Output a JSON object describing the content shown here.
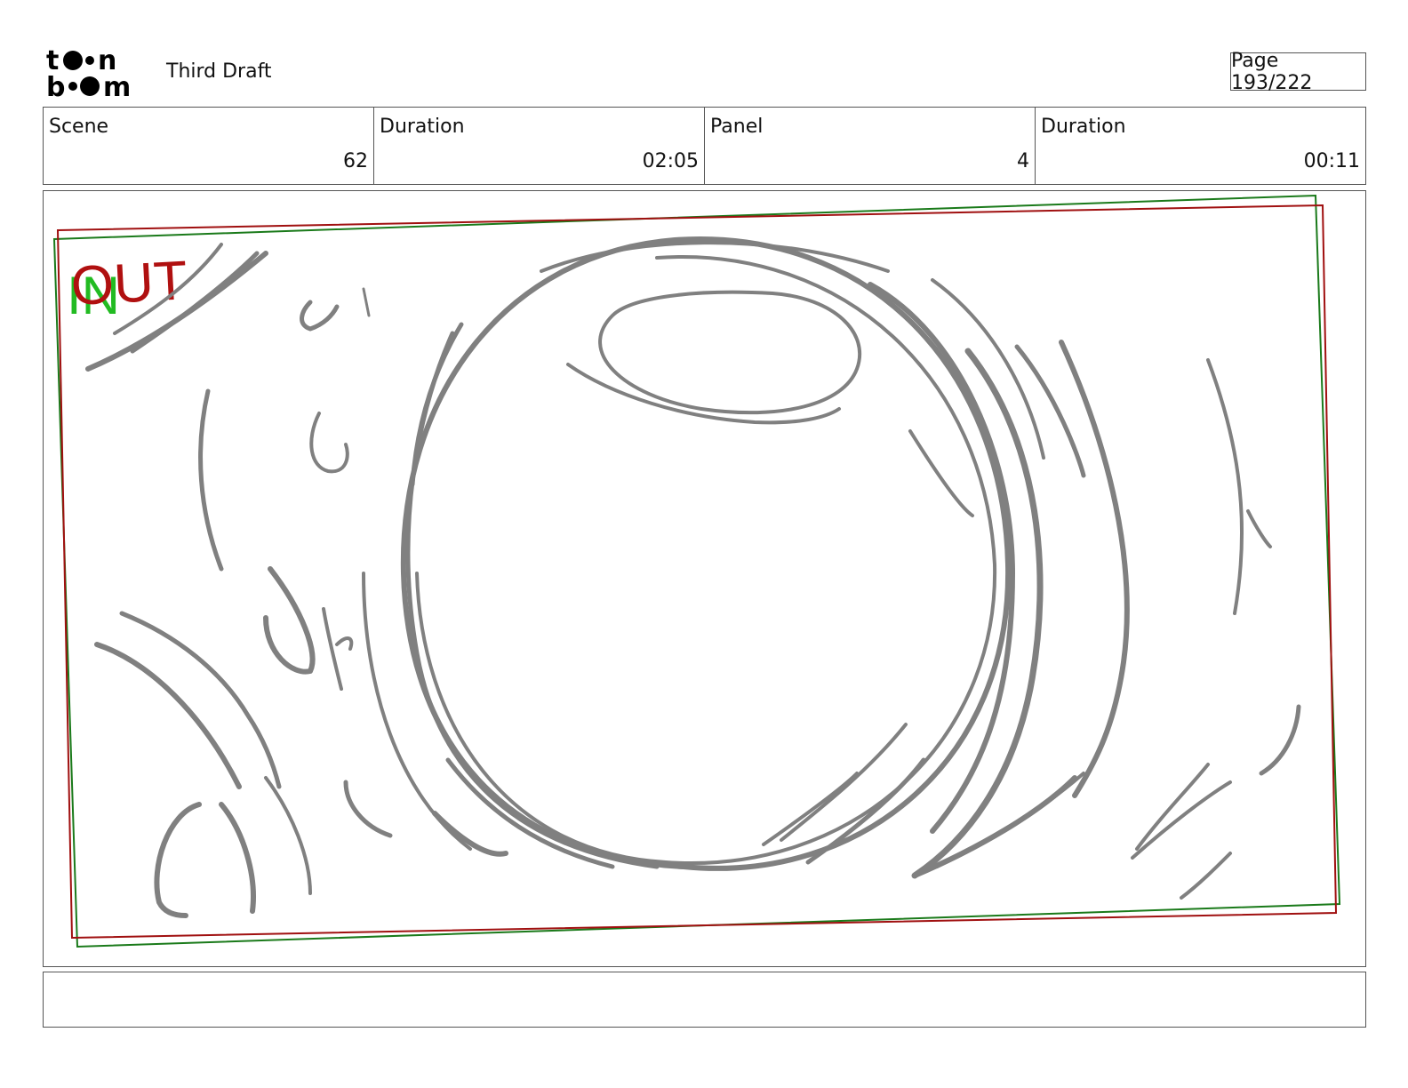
{
  "header": {
    "logo_text": "toon boom",
    "document_title": "Third Draft",
    "page_indicator": "Page 193/222"
  },
  "info": {
    "scene_label": "Scene",
    "scene_value": "62",
    "scene_duration_label": "Duration",
    "scene_duration_value": "02:05",
    "panel_label": "Panel",
    "panel_value": "4",
    "panel_duration_label": "Duration",
    "panel_duration_value": "00:11"
  },
  "panel": {
    "in_marker": "IN",
    "out_marker": "OUT",
    "colors": {
      "in_frame": "#1a7a1a",
      "out_frame": "#a01010",
      "in_text": "#22bb22",
      "out_text": "#b01010",
      "sketch": "#808080"
    }
  },
  "notes": {
    "text": ""
  }
}
